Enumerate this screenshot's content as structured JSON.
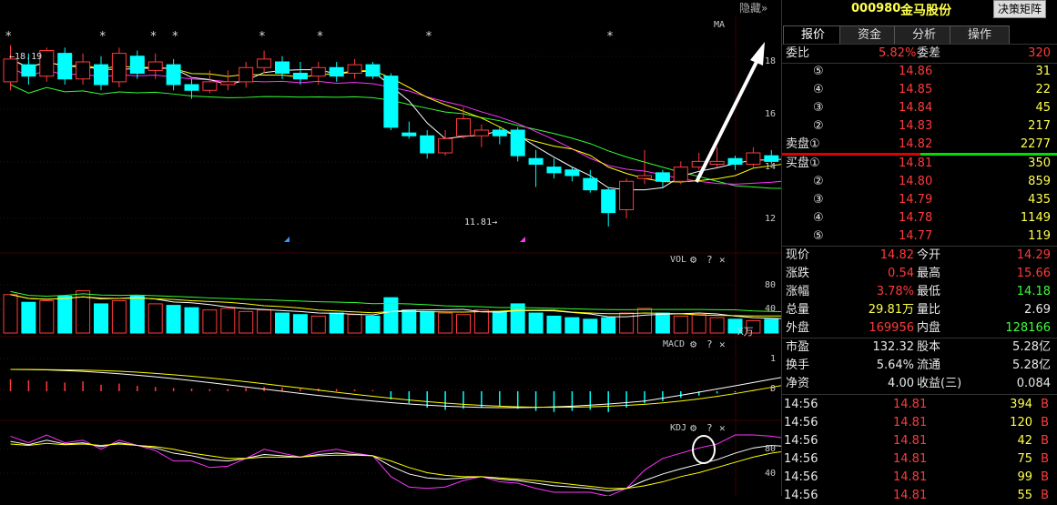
{
  "header": {
    "hide_label": "隐藏",
    "stock_code": "000980",
    "stock_name": "金马股份",
    "decision_button": "决策矩阵"
  },
  "tabs": [
    {
      "label": "报价"
    },
    {
      "label": "资金"
    },
    {
      "label": "分析"
    },
    {
      "label": "操作"
    }
  ],
  "order_book": {
    "weibi_label": "委比",
    "weibi_value": "5.82%",
    "weicha_label": "委差",
    "weicha_value": "320",
    "asks": [
      {
        "label": "⑤",
        "price": "14.86",
        "vol": "31"
      },
      {
        "label": "④",
        "price": "14.85",
        "vol": "22"
      },
      {
        "label": "③",
        "price": "14.84",
        "vol": "45"
      },
      {
        "label": "②",
        "price": "14.83",
        "vol": "217"
      },
      {
        "label": "卖盘①",
        "price": "14.82",
        "vol": "2277"
      }
    ],
    "bids": [
      {
        "label": "买盘①",
        "price": "14.81",
        "vol": "350"
      },
      {
        "label": "②",
        "price": "14.80",
        "vol": "859"
      },
      {
        "label": "③",
        "price": "14.79",
        "vol": "435"
      },
      {
        "label": "④",
        "price": "14.78",
        "vol": "1149"
      },
      {
        "label": "⑤",
        "price": "14.77",
        "vol": "119"
      }
    ]
  },
  "stats": [
    {
      "l1": "现价",
      "v1": "14.82",
      "c1": "red",
      "l2": "今开",
      "v2": "14.29",
      "c2": "red"
    },
    {
      "l1": "涨跌",
      "v1": "0.54",
      "c1": "red",
      "l2": "最高",
      "v2": "15.66",
      "c2": "red"
    },
    {
      "l1": "涨幅",
      "v1": "3.78%",
      "c1": "red",
      "l2": "最低",
      "v2": "14.18",
      "c2": "green"
    },
    {
      "l1": "总量",
      "v1": "29.81万",
      "c1": "yellow",
      "l2": "量比",
      "v2": "2.69",
      "c2": "white"
    },
    {
      "l1": "外盘",
      "v1": "169956",
      "c1": "red",
      "l2": "内盘",
      "v2": "128166",
      "c2": "green"
    }
  ],
  "fundamentals": [
    {
      "l1": "市盈",
      "v1": "132.32",
      "l2": "股本",
      "v2": "5.28亿"
    },
    {
      "l1": "换手",
      "v1": "5.64%",
      "l2": "流通",
      "v2": "5.28亿"
    },
    {
      "l1": "净资",
      "v1": "4.00",
      "l2": "收益(三)",
      "v2": "0.084"
    }
  ],
  "ticks": [
    {
      "time": "14:56",
      "price": "14.81",
      "vol": "394",
      "side": "B"
    },
    {
      "time": "14:56",
      "price": "14.81",
      "vol": "120",
      "side": "B"
    },
    {
      "time": "14:56",
      "price": "14.81",
      "vol": "42",
      "side": "B"
    },
    {
      "time": "14:56",
      "price": "14.81",
      "vol": "75",
      "side": "B"
    },
    {
      "time": "14:56",
      "price": "14.81",
      "vol": "99",
      "side": "B"
    },
    {
      "time": "14:56",
      "price": "14.81",
      "vol": "55",
      "side": "B"
    }
  ],
  "chart": {
    "ma_label": "MA",
    "high_label": "18.19",
    "low_label": "11.81",
    "price_ticks": [
      "18",
      "16",
      "14",
      "12"
    ],
    "vol_label": "VOL",
    "vol_unit": "X万",
    "vol_ticks": [
      "80",
      "40"
    ],
    "macd_label": "MACD",
    "macd_ticks": [
      "1",
      "0"
    ],
    "kdj_label": "KDJ",
    "kdj_ticks": [
      "80",
      "40"
    ],
    "settings_glyph": "⚙",
    "help_glyph": "?",
    "close_glyph": "✕"
  },
  "colors": {
    "up": "#ff3b3b",
    "down": "#00ffff",
    "ma5": "#ffffff",
    "ma10": "#ffff00",
    "ma20": "#ff33ff",
    "ma60": "#33ff33"
  },
  "chart_data": {
    "type": "candlestick",
    "candles": [
      [
        16.9,
        17.7,
        18.19,
        16.6
      ],
      [
        17.5,
        17.1,
        17.9,
        16.8
      ],
      [
        17.1,
        18.0,
        18.1,
        16.9
      ],
      [
        17.9,
        17.0,
        18.1,
        16.8
      ],
      [
        17.0,
        17.6,
        17.9,
        16.8
      ],
      [
        17.5,
        16.8,
        17.8,
        16.6
      ],
      [
        16.9,
        17.9,
        18.1,
        16.7
      ],
      [
        17.8,
        17.2,
        18.0,
        17.0
      ],
      [
        17.3,
        17.6,
        17.9,
        17.0
      ],
      [
        17.5,
        16.8,
        17.7,
        16.6
      ],
      [
        16.8,
        16.6,
        17.0,
        16.3
      ],
      [
        16.6,
        16.9,
        17.3,
        16.5
      ],
      [
        16.8,
        16.9,
        17.3,
        16.6
      ],
      [
        16.9,
        17.4,
        17.6,
        16.7
      ],
      [
        17.4,
        17.7,
        18.0,
        17.2
      ],
      [
        17.6,
        17.2,
        17.8,
        17.0
      ],
      [
        17.2,
        17.0,
        17.6,
        16.8
      ],
      [
        17.1,
        17.4,
        17.6,
        16.8
      ],
      [
        17.4,
        17.1,
        17.6,
        16.9
      ],
      [
        17.2,
        17.5,
        17.7,
        17.0
      ],
      [
        17.5,
        17.1,
        17.6,
        17.0
      ],
      [
        17.1,
        15.3,
        17.2,
        15.2
      ],
      [
        15.1,
        15.0,
        15.5,
        14.9
      ],
      [
        15.0,
        14.4,
        15.2,
        14.2
      ],
      [
        14.4,
        14.9,
        15.2,
        14.3
      ],
      [
        15.0,
        15.6,
        16.0,
        14.9
      ],
      [
        15.0,
        15.2,
        15.4,
        14.6
      ],
      [
        15.2,
        15.0,
        15.3,
        14.7
      ],
      [
        15.2,
        14.3,
        15.3,
        14.1
      ],
      [
        14.2,
        14.0,
        14.5,
        13.2
      ],
      [
        13.9,
        13.7,
        14.2,
        13.5
      ],
      [
        13.8,
        13.6,
        13.9,
        13.4
      ],
      [
        13.5,
        13.1,
        13.8,
        13.0
      ],
      [
        13.1,
        12.3,
        13.2,
        11.81
      ],
      [
        12.4,
        13.4,
        13.5,
        12.1
      ],
      [
        13.5,
        13.6,
        14.5,
        13.3
      ],
      [
        13.7,
        13.4,
        13.8,
        13.2
      ],
      [
        13.4,
        13.9,
        14.1,
        13.3
      ],
      [
        13.9,
        14.1,
        14.4,
        13.8
      ],
      [
        14.0,
        14.1,
        14.6,
        13.9
      ],
      [
        14.2,
        14.0,
        14.3,
        13.8
      ],
      [
        14.0,
        14.4,
        14.6,
        13.9
      ],
      [
        14.3,
        14.1,
        14.5,
        14.0
      ],
      [
        14.1,
        14.3,
        14.6,
        13.9
      ],
      [
        14.29,
        14.82,
        15.66,
        14.18
      ]
    ],
    "ylim": [
      11.2,
      19.2
    ],
    "volume": [
      50,
      40,
      42,
      48,
      55,
      38,
      42,
      48,
      38,
      36,
      33,
      30,
      32,
      28,
      30,
      26,
      24,
      22,
      26,
      24,
      22,
      46,
      30,
      28,
      26,
      24,
      30,
      28,
      38,
      26,
      22,
      20,
      18,
      20,
      26,
      32,
      26,
      22,
      24,
      20,
      18,
      16,
      18,
      20,
      28
    ],
    "macd_bars": [
      0.22,
      0.2,
      0.18,
      0.16,
      0.18,
      0.12,
      0.14,
      0.1,
      0.08,
      0.06,
      0.05,
      0.04,
      0.04,
      0.06,
      0.08,
      0.07,
      0.05,
      0.05,
      0.04,
      0.03,
      0.02,
      -0.15,
      -0.22,
      -0.3,
      -0.34,
      -0.32,
      -0.3,
      -0.28,
      -0.32,
      -0.36,
      -0.38,
      -0.36,
      -0.34,
      -0.38,
      -0.3,
      -0.22,
      -0.18,
      -0.12,
      -0.08,
      -0.04,
      -0.02,
      0.02,
      0.04,
      0.06,
      0.12
    ],
    "kdj_k": [
      90,
      85,
      92,
      86,
      88,
      82,
      88,
      84,
      80,
      72,
      68,
      62,
      60,
      64,
      70,
      68,
      66,
      70,
      72,
      70,
      68,
      52,
      40,
      34,
      32,
      34,
      36,
      32,
      30,
      26,
      22,
      20,
      18,
      14,
      18,
      30,
      40,
      48,
      55,
      62,
      72,
      80,
      84,
      82,
      78
    ],
    "kdj_d": [
      86,
      84,
      87,
      85,
      86,
      84,
      86,
      84,
      82,
      78,
      72,
      68,
      64,
      64,
      66,
      66,
      66,
      68,
      69,
      69,
      68,
      60,
      50,
      42,
      38,
      36,
      36,
      34,
      32,
      30,
      27,
      24,
      21,
      18,
      18,
      22,
      28,
      36,
      42,
      50,
      58,
      66,
      72,
      76,
      77
    ],
    "kdj_j": [
      98,
      88,
      100,
      88,
      92,
      78,
      92,
      84,
      76,
      60,
      60,
      50,
      52,
      64,
      78,
      72,
      66,
      74,
      78,
      72,
      68,
      36,
      20,
      18,
      20,
      30,
      36,
      28,
      26,
      18,
      12,
      12,
      12,
      6,
      18,
      46,
      64,
      72,
      80,
      86,
      100,
      100,
      98,
      94,
      80
    ]
  }
}
